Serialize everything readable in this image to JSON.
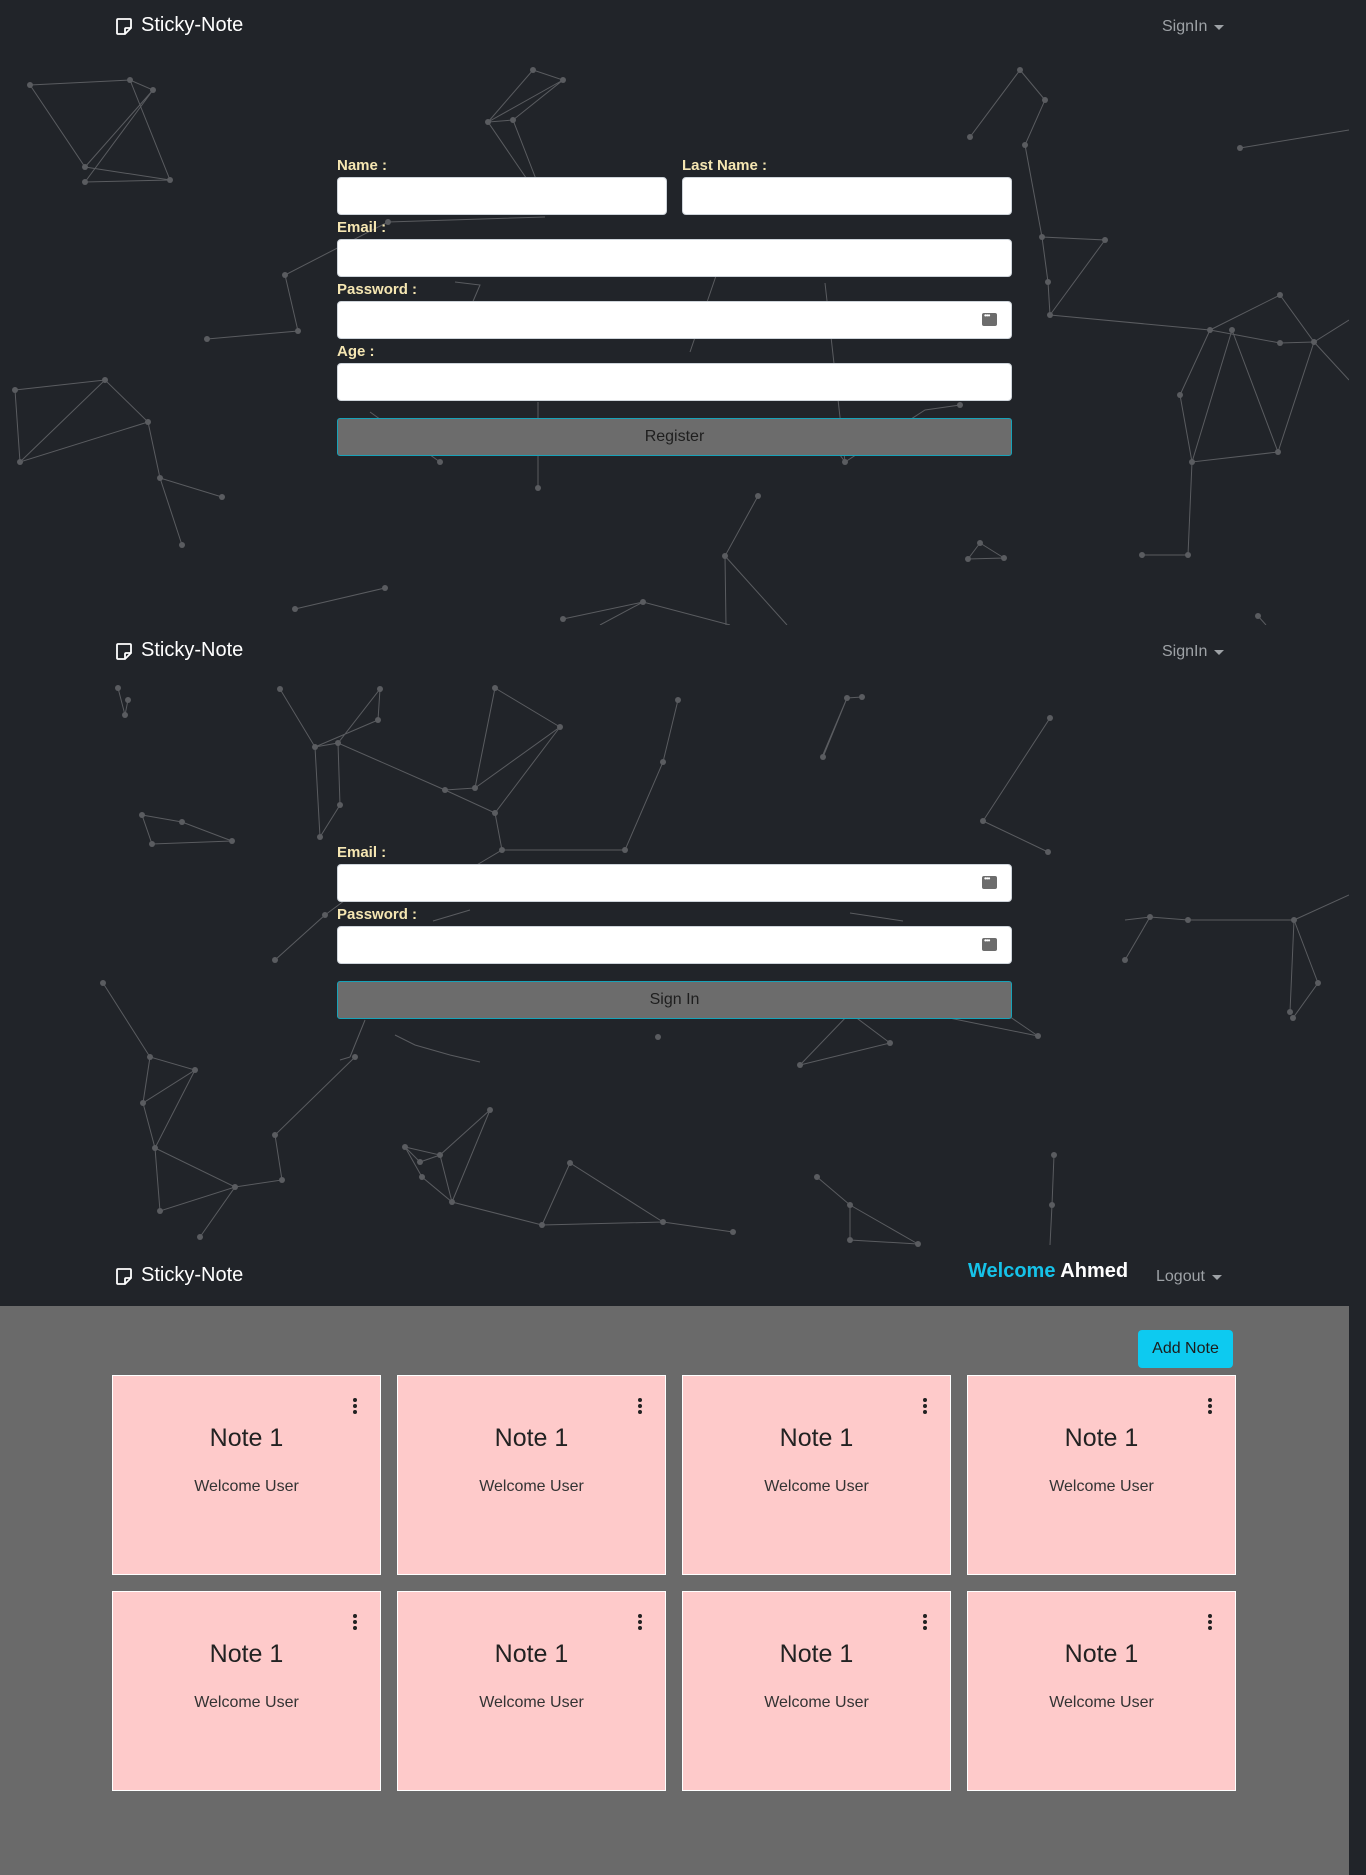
{
  "app": {
    "brand": "Sticky-Note",
    "brand_icon": "sticky-note-icon"
  },
  "register_view": {
    "nav_dropdown": "SignIn",
    "labels": {
      "name": "Name :",
      "last_name": "Last Name :",
      "email": "Email :",
      "password": "Password :",
      "age": "Age :"
    },
    "values": {
      "name": "",
      "last_name": "",
      "email": "",
      "password": "",
      "age": ""
    },
    "submit_label": "Register"
  },
  "signin_view": {
    "nav_dropdown": "SignIn",
    "labels": {
      "email": "Email :",
      "password": "Password :"
    },
    "values": {
      "email": "",
      "password": ""
    },
    "submit_label": "Sign In"
  },
  "notes_view": {
    "welcome_word": "Welcome",
    "user_name": "Ahmed",
    "nav_dropdown": "Logout",
    "add_button": "Add Note",
    "notes": [
      {
        "title": "Note 1",
        "body": "Welcome User"
      },
      {
        "title": "Note 1",
        "body": "Welcome User"
      },
      {
        "title": "Note 1",
        "body": "Welcome User"
      },
      {
        "title": "Note 1",
        "body": "Welcome User"
      },
      {
        "title": "Note 1",
        "body": "Welcome User"
      },
      {
        "title": "Note 1",
        "body": "Welcome User"
      },
      {
        "title": "Note 1",
        "body": "Welcome User"
      },
      {
        "title": "Note 1",
        "body": "Welcome User"
      }
    ]
  },
  "colors": {
    "background": "#212429",
    "label": "#f5e6b2",
    "accent": "#0dcaf0",
    "welcome_accent": "#16c2e8",
    "note": "#fecaca",
    "notes_area": "#6a6a6a",
    "button": "#6c6c6c"
  }
}
